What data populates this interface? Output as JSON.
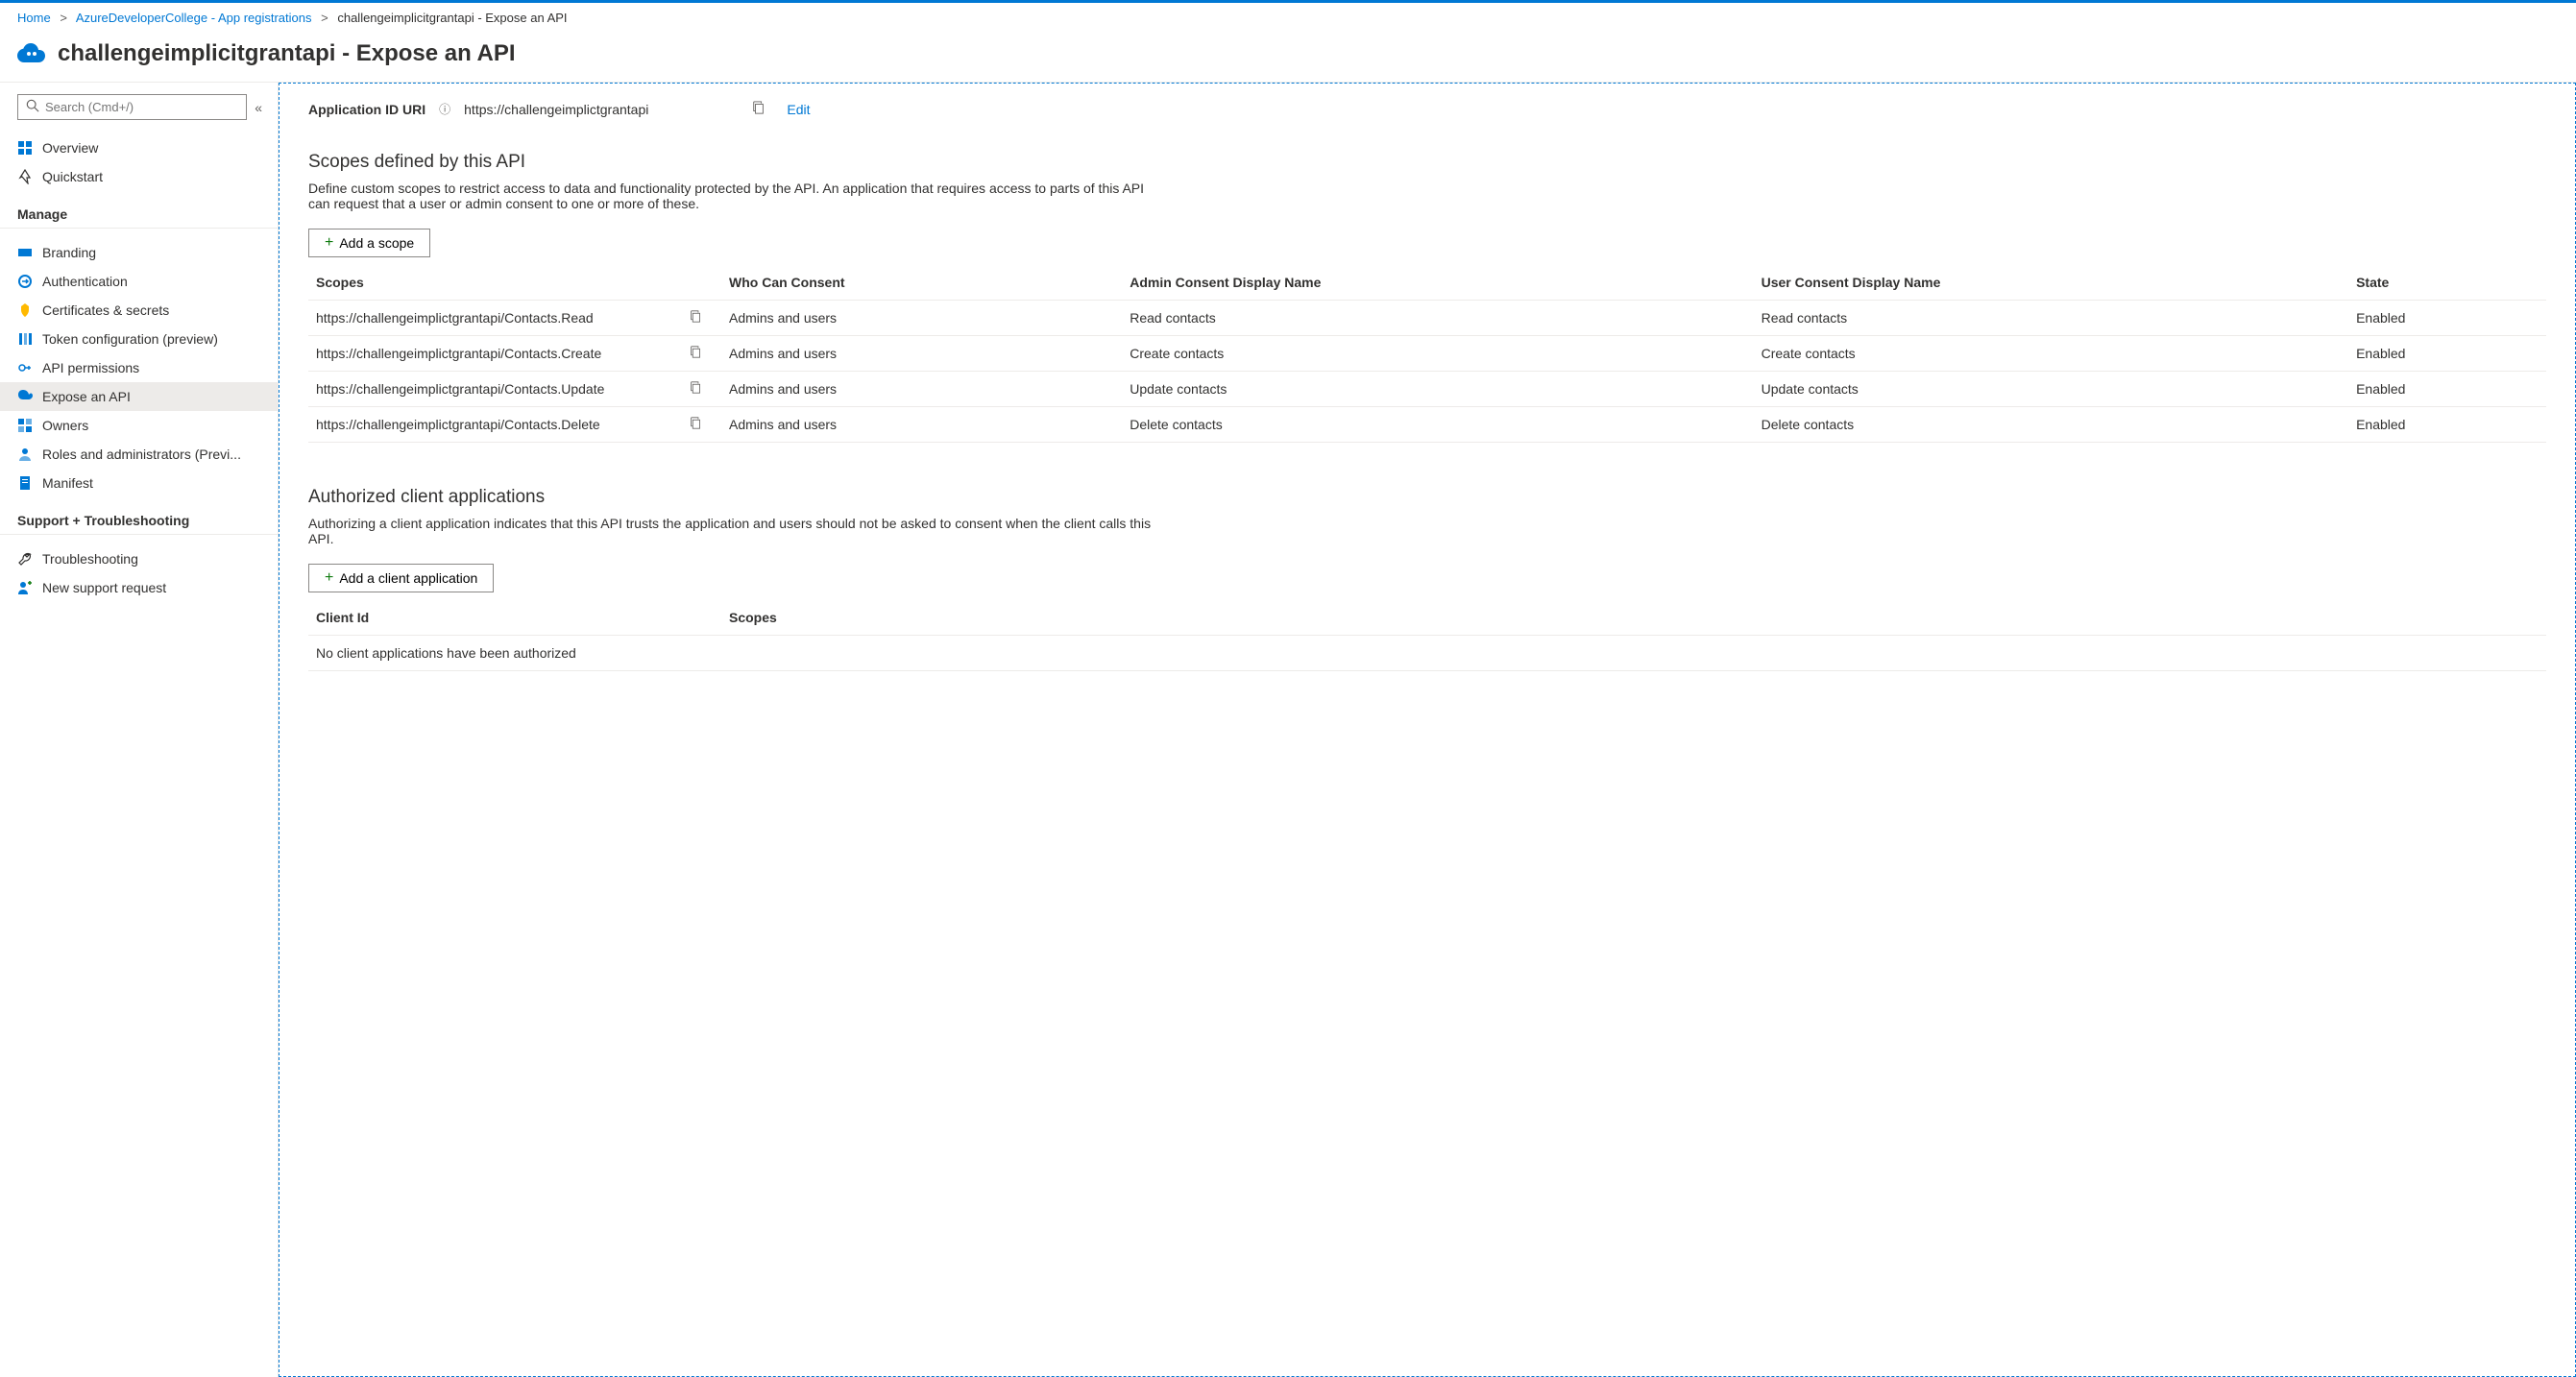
{
  "breadcrumb": {
    "home": "Home",
    "level1": "AzureDeveloperCollege - App registrations",
    "current": "challengeimplicitgrantapi - Expose an API"
  },
  "header": {
    "title": "challengeimplicitgrantapi - Expose an API"
  },
  "search": {
    "placeholder": "Search (Cmd+/)"
  },
  "sidebar": {
    "plain": [
      {
        "label": "Overview"
      },
      {
        "label": "Quickstart"
      }
    ],
    "manage_heading": "Manage",
    "manage": [
      {
        "label": "Branding"
      },
      {
        "label": "Authentication"
      },
      {
        "label": "Certificates & secrets"
      },
      {
        "label": "Token configuration (preview)"
      },
      {
        "label": "API permissions"
      },
      {
        "label": "Expose an API"
      },
      {
        "label": "Owners"
      },
      {
        "label": "Roles and administrators (Previ..."
      },
      {
        "label": "Manifest"
      }
    ],
    "support_heading": "Support + Troubleshooting",
    "support": [
      {
        "label": "Troubleshooting"
      },
      {
        "label": "New support request"
      }
    ]
  },
  "appUri": {
    "label": "Application ID URI",
    "value": "https://challengeimplictgrantapi",
    "edit": "Edit"
  },
  "scopesSection": {
    "title": "Scopes defined by this API",
    "desc": "Define custom scopes to restrict access to data and functionality protected by the API. An application that requires access to parts of this API can request that a user or admin consent to one or more of these.",
    "addBtn": "Add a scope",
    "cols": {
      "scopes": "Scopes",
      "who": "Who Can Consent",
      "admin": "Admin Consent Display Name",
      "user": "User Consent Display Name",
      "state": "State"
    },
    "rows": [
      {
        "scope": "https://challengeimplictgrantapi/Contacts.Read",
        "who": "Admins and users",
        "admin": "Read contacts",
        "user": "Read contacts",
        "state": "Enabled"
      },
      {
        "scope": "https://challengeimplictgrantapi/Contacts.Create",
        "who": "Admins and users",
        "admin": "Create contacts",
        "user": "Create contacts",
        "state": "Enabled"
      },
      {
        "scope": "https://challengeimplictgrantapi/Contacts.Update",
        "who": "Admins and users",
        "admin": "Update contacts",
        "user": "Update contacts",
        "state": "Enabled"
      },
      {
        "scope": "https://challengeimplictgrantapi/Contacts.Delete",
        "who": "Admins and users",
        "admin": "Delete contacts",
        "user": "Delete contacts",
        "state": "Enabled"
      }
    ]
  },
  "clientsSection": {
    "title": "Authorized client applications",
    "desc": "Authorizing a client application indicates that this API trusts the application and users should not be asked to consent when the client calls this API.",
    "addBtn": "Add a client application",
    "cols": {
      "clientId": "Client Id",
      "scopes": "Scopes"
    },
    "empty": "No client applications have been authorized"
  }
}
